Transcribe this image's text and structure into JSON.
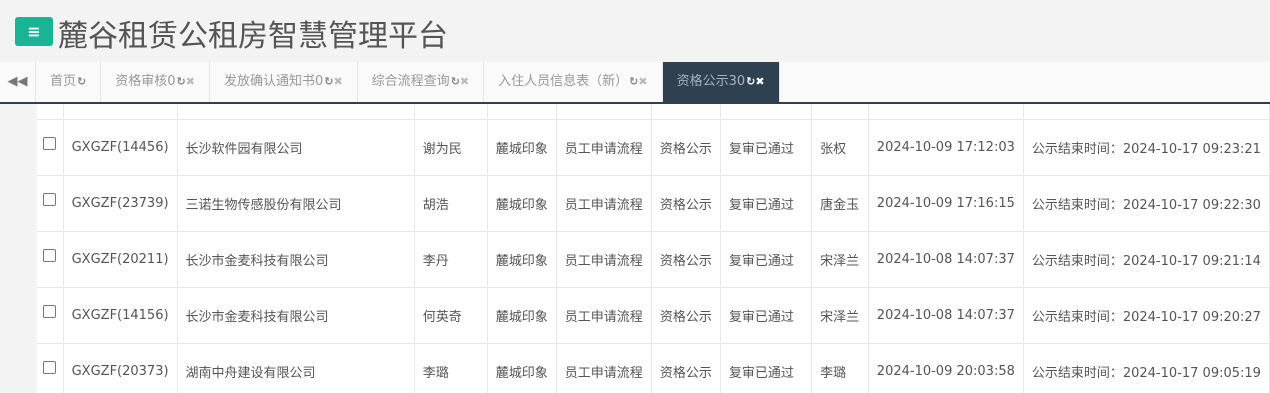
{
  "app": {
    "menu_icon": "hamburger-icon",
    "menu_glyph": "≡",
    "title": "麓谷租赁公租房智慧管理平台"
  },
  "tabs": {
    "nav_left_glyph": "◀◀",
    "items": [
      {
        "label": "首页",
        "closable": false
      },
      {
        "label": "资格审核0",
        "closable": true
      },
      {
        "label": "发放确认通知书0",
        "closable": true
      },
      {
        "label": "综合流程查询",
        "closable": true
      },
      {
        "label": "入住人员信息表（新）",
        "closable": true
      },
      {
        "label": "资格公示30",
        "closable": true,
        "active": true
      }
    ],
    "refresh_glyph": "↻",
    "close_glyph": "✖"
  },
  "table": {
    "rows": [
      {
        "id": "GXGZF(14456)",
        "company": "长沙软件园有限公司",
        "name": "谢为民",
        "area": "麓城印象",
        "flow": "员工申请流程",
        "stage": "资格公示",
        "status": "复审已通过",
        "operator": "张权",
        "time": "2024-10-09 17:12:03",
        "notice": "公示结束时间：2024-10-17 09:23:21"
      },
      {
        "id": "GXGZF(23739)",
        "company": "三诺生物传感股份有限公司",
        "name": "胡浩",
        "area": "麓城印象",
        "flow": "员工申请流程",
        "stage": "资格公示",
        "status": "复审已通过",
        "operator": "唐金玉",
        "time": "2024-10-09 17:16:15",
        "notice": "公示结束时间：2024-10-17 09:22:30"
      },
      {
        "id": "GXGZF(20211)",
        "company": "长沙市金麦科技有限公司",
        "name": "李丹",
        "area": "麓城印象",
        "flow": "员工申请流程",
        "stage": "资格公示",
        "status": "复审已通过",
        "operator": "宋泽兰",
        "time": "2024-10-08 14:07:37",
        "notice": "公示结束时间：2024-10-17 09:21:14"
      },
      {
        "id": "GXGZF(14156)",
        "company": "长沙市金麦科技有限公司",
        "name": "何英奇",
        "area": "麓城印象",
        "flow": "员工申请流程",
        "stage": "资格公示",
        "status": "复审已通过",
        "operator": "宋泽兰",
        "time": "2024-10-08 14:07:37",
        "notice": "公示结束时间：2024-10-17 09:20:27"
      },
      {
        "id": "GXGZF(20373)",
        "company": "湖南中舟建设有限公司",
        "name": "李璐",
        "area": "麓城印象",
        "flow": "员工申请流程",
        "stage": "资格公示",
        "status": "复审已通过",
        "operator": "李璐",
        "time": "2024-10-09 20:03:58",
        "notice": "公示结束时间：2024-10-17 09:05:19"
      }
    ]
  }
}
